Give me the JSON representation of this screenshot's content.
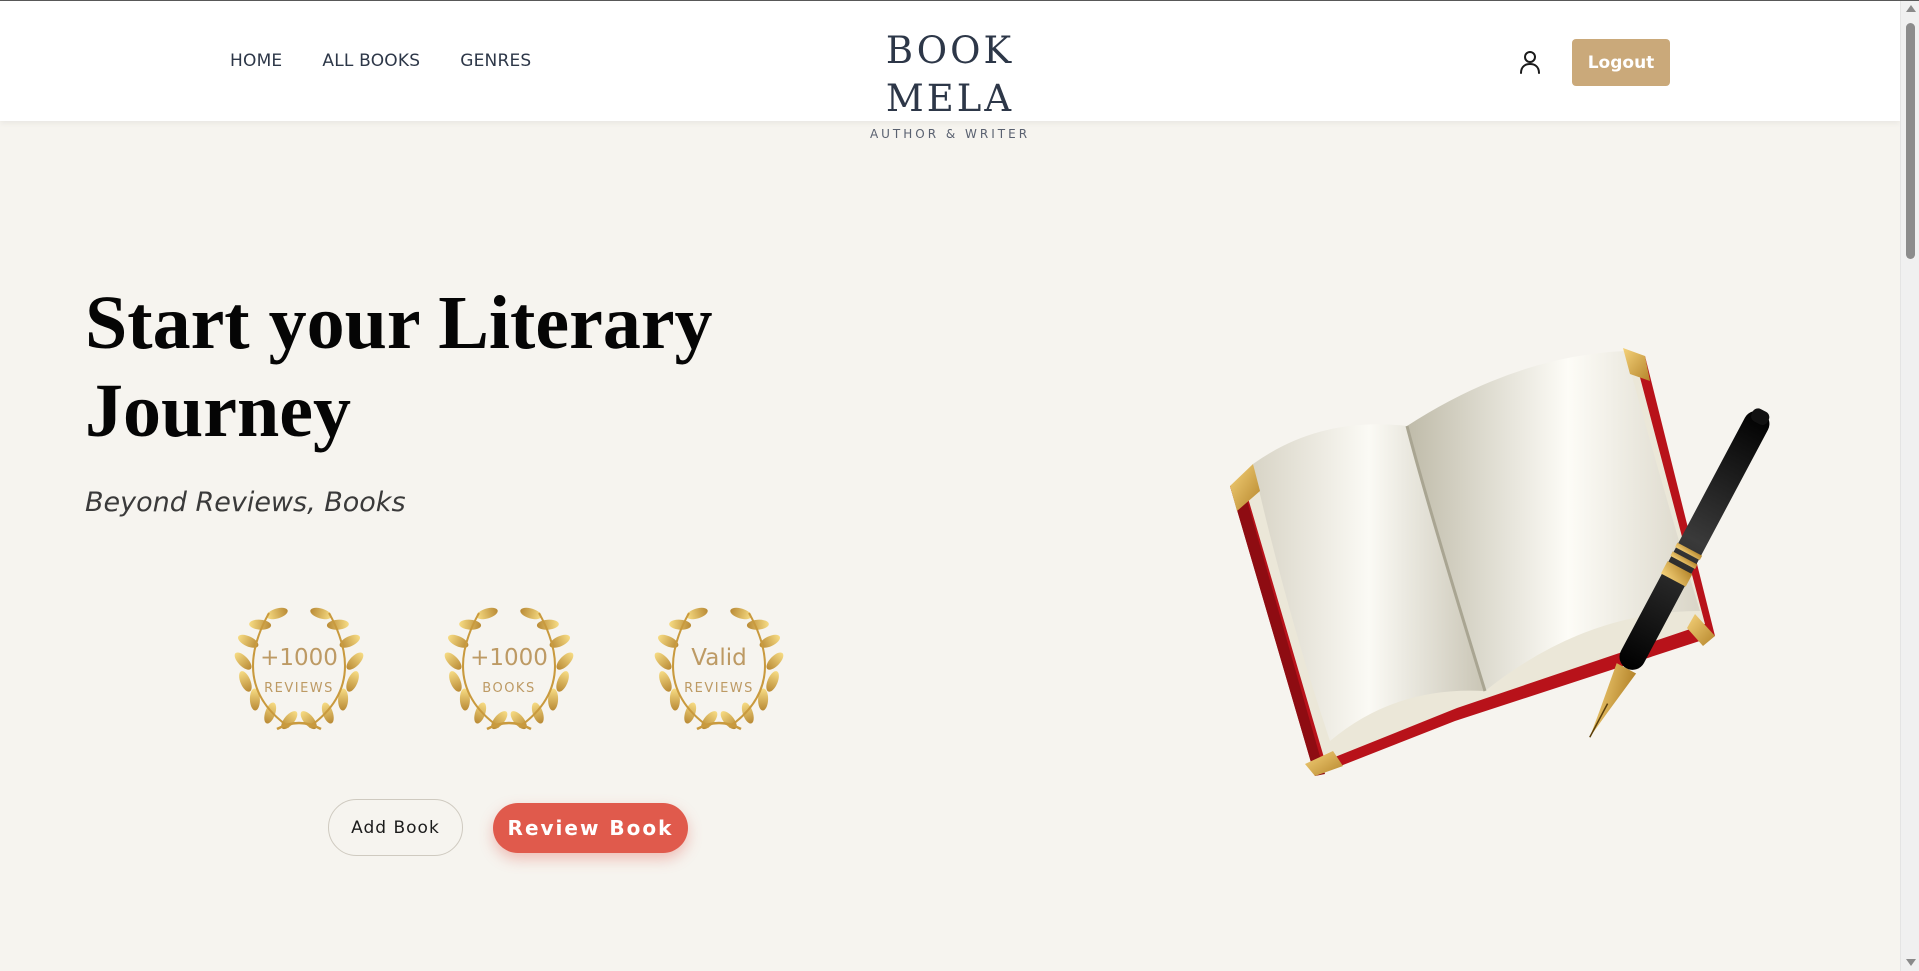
{
  "header": {
    "nav": [
      {
        "label": "HOME"
      },
      {
        "label": "ALL BOOKS"
      },
      {
        "label": "GENRES"
      }
    ],
    "brand": {
      "title": "BOOK MELA",
      "subtitle": "AUTHOR & WRITER"
    },
    "user_icon": "user-icon",
    "logout_label": "Logout"
  },
  "hero": {
    "title_line1": "Start your Literary",
    "title_line2": "Journey",
    "subtitle": "Beyond Reviews, Books",
    "badges": [
      {
        "value": "+1000",
        "label": "REVIEWS",
        "icon": "laurel-wreath-icon"
      },
      {
        "value": "+1000",
        "label": "BOOKS",
        "icon": "laurel-wreath-icon"
      },
      {
        "value": "Valid",
        "label": "REVIEWS",
        "icon": "laurel-wreath-icon"
      }
    ],
    "add_book_label": "Add Book",
    "review_book_label": "Review Book",
    "illustration": "open-book-with-fountain-pen"
  },
  "colors": {
    "background": "#f6f4ef",
    "gold": "#caa97a",
    "accent_red": "#e05a4c",
    "text_dark": "#2d3748"
  }
}
